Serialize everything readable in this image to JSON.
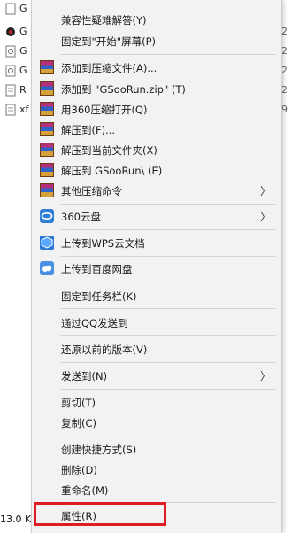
{
  "background": {
    "rows": [
      {
        "name": "G",
        "right": "2"
      },
      {
        "name": "G",
        "right": "2"
      },
      {
        "name": "G",
        "right": "2"
      },
      {
        "name": "R",
        "right": "2"
      },
      {
        "name": "xf",
        "right": "9"
      }
    ],
    "status_left": "13.0 K"
  },
  "menu": {
    "compat_troubleshoot": "兼容性疑难解答(Y)",
    "pin_start": "固定到\"开始\"屏幕(P)",
    "add_to_archive": "添加到压缩文件(A)...",
    "add_to_zip": "添加到 \"GSooRun.zip\" (T)",
    "open_360": "用360压缩打开(Q)",
    "extract_to": "解压到(F)...",
    "extract_here": "解压到当前文件夹(X)",
    "extract_folder": "解压到 GSooRun\\ (E)",
    "more_compress": "其他压缩命令",
    "cloud_360": "360云盘",
    "upload_wps": "上传到WPS云文档",
    "upload_baidu": "上传到百度网盘",
    "pin_taskbar": "固定到任务栏(K)",
    "send_qq": "通过QQ发送到",
    "restore_prev": "还原以前的版本(V)",
    "send_to": "发送到(N)",
    "cut": "剪切(T)",
    "copy": "复制(C)",
    "create_shortcut": "创建快捷方式(S)",
    "delete": "删除(D)",
    "rename": "重命名(M)",
    "properties": "属性(R)",
    "arrow": "〉"
  },
  "colors": {
    "highlight": "#e01b24"
  }
}
